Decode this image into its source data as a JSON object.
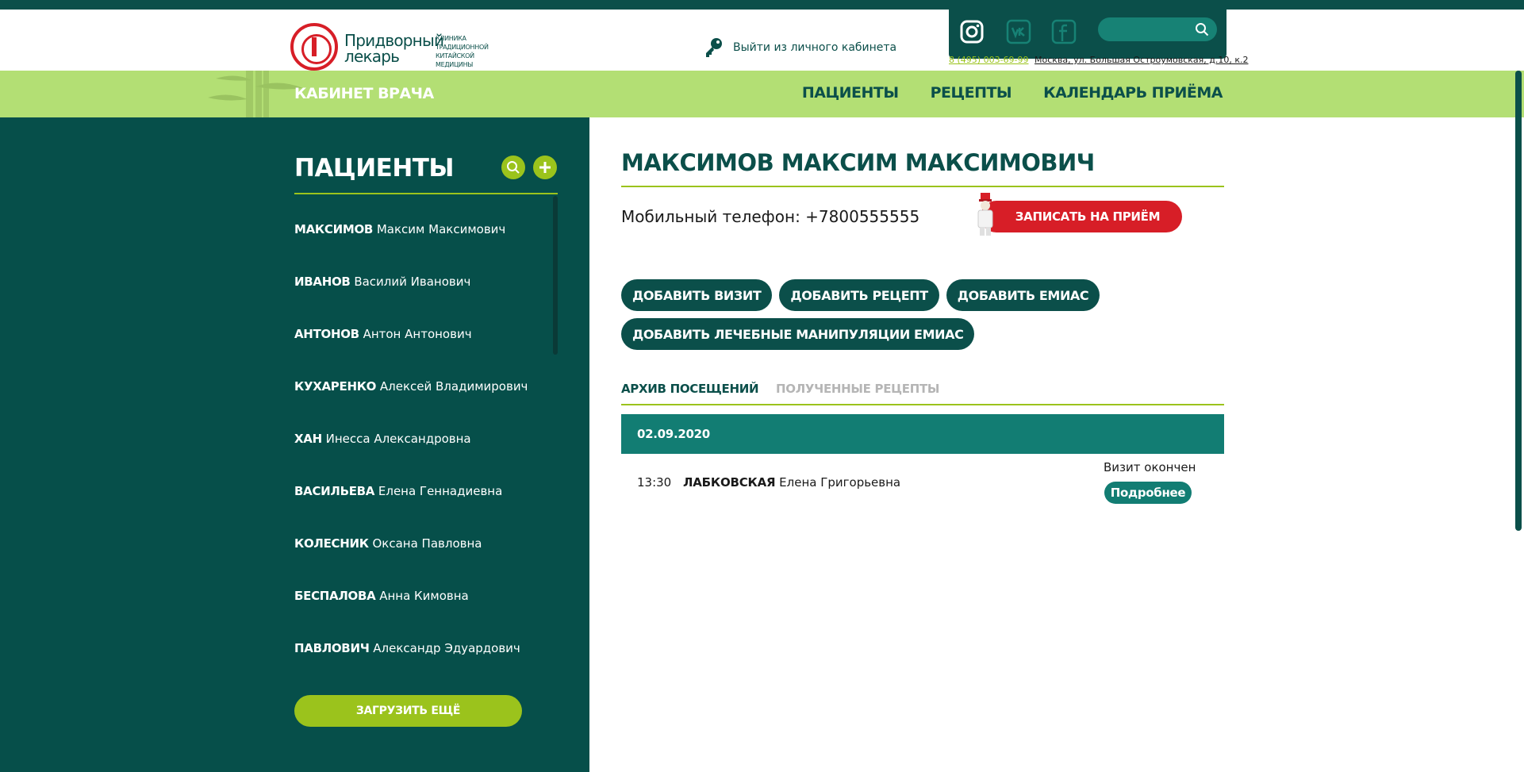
{
  "header": {
    "logo": {
      "seal_text": "ПРИДВОРНЫЙ ЛЕКАРЬ",
      "name": "Придворный лекарь",
      "subtitle": "КЛИНИКА ТРАДИЦИОННОЙ КИТАЙСКОЙ МЕДИЦИНЫ"
    },
    "logout_label": "Выйти из личного кабинета",
    "logout_icon": "key-icon",
    "social_icons": [
      "instagram-icon",
      "vk-icon",
      "facebook-icon"
    ],
    "search": {
      "placeholder": "",
      "value": "",
      "icon": "search-icon"
    },
    "phone": "8 (495) 003-69-99",
    "address": "Москва, ул. Большая Остроумовская, д.10, к.2"
  },
  "nav": {
    "title": "КАБИНЕТ ВРАЧА",
    "links": [
      "ПАЦИЕНТЫ",
      "РЕЦЕПТЫ",
      "КАЛЕНДАРЬ ПРИЁМА"
    ]
  },
  "sidebar": {
    "title": "ПАЦИЕНТЫ",
    "patients": [
      {
        "surname": "МАКСИМОВ",
        "name": "Максим Максимович"
      },
      {
        "surname": "ИВАНОВ",
        "name": "Василий Иванович"
      },
      {
        "surname": "АНТОНОВ",
        "name": "Антон Антонович"
      },
      {
        "surname": "КУХАРЕНКО",
        "name": "Алексей Владимирович"
      },
      {
        "surname": "ХАН",
        "name": "Инесса Александровна"
      },
      {
        "surname": "ВАСИЛЬЕВА",
        "name": "Елена Геннадиевна"
      },
      {
        "surname": "КОЛЕСНИК",
        "name": "Оксана Павловна"
      },
      {
        "surname": "БЕСПАЛОВА",
        "name": "Анна Кимовна"
      },
      {
        "surname": "ПАВЛОВИЧ",
        "name": "Александр Эдуардович"
      }
    ],
    "load_more": "ЗАГРУЗИТЬ ЕЩЁ"
  },
  "main": {
    "patient_name": "МАКСИМОВ МАКСИМ МАКСИМОВИЧ",
    "phone_label": "Мобильный телефон:",
    "phone_value": "+7800555555",
    "appoint_button": "ЗАПИСАТЬ НА ПРИЁМ",
    "actions": [
      "ДОБАВИТЬ ВИЗИТ",
      "ДОБАВИТЬ РЕЦЕПТ",
      "ДОБАВИТЬ ЕМИАС",
      "ДОБАВИТЬ ЛЕЧЕБНЫЕ МАНИПУЛЯЦИИ ЕМИАС"
    ],
    "tabs": [
      "АРХИВ ПОСЕЩЕНИЙ",
      "ПОЛУЧЕННЫЕ РЕЦЕПТЫ"
    ],
    "visits": [
      {
        "date": "02.09.2020",
        "time": "13:30",
        "doctor_surname": "ЛАБКОВСКАЯ",
        "doctor_name": "Елена Григорьевна",
        "status": "Визит окончен",
        "details_button": "Подробнее"
      }
    ]
  },
  "colors": {
    "dark_green": "#0b4f4a",
    "sidebar_green": "#064f4a",
    "light_green": "#b3df74",
    "lime": "#9bc31c",
    "teal": "#127d73",
    "red": "#d71e27"
  }
}
